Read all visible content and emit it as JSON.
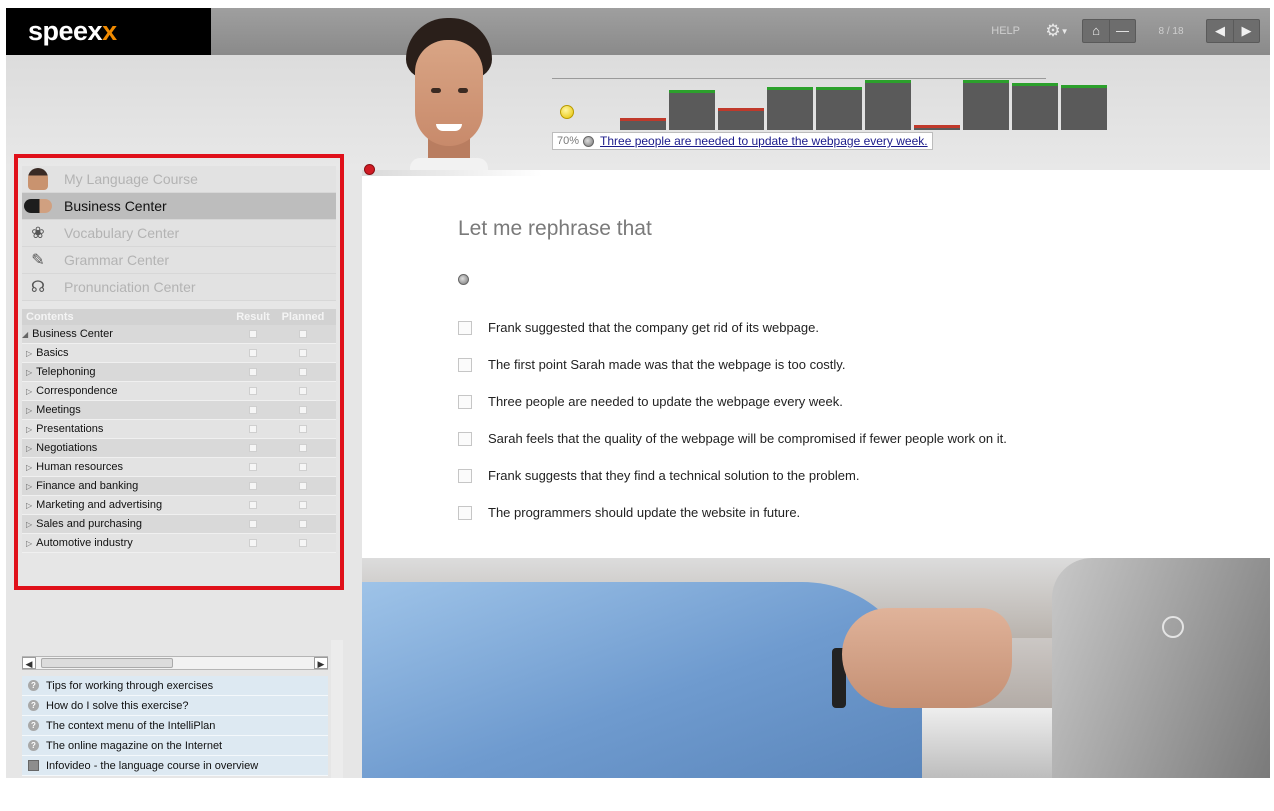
{
  "app": {
    "logo_text": "speex",
    "logo_accent": "x",
    "accent_color": "#f08a00"
  },
  "topbar": {
    "help_label": "HELP",
    "gear_icon": "gear-icon",
    "home_icon": "home-icon",
    "minimize_icon": "minimize-icon",
    "page_counter": "8 / 18",
    "prev_icon": "prev-icon",
    "next_icon": "next-icon"
  },
  "progress": {
    "percent_label": "70%",
    "current_sentence": "Three people are needed to update the webpage every week.",
    "status_color": "#e6c200",
    "answers": [
      {
        "level": 0.24,
        "correct": false
      },
      {
        "level": 0.8,
        "correct": true
      },
      {
        "level": 0.44,
        "correct": false
      },
      {
        "level": 0.86,
        "correct": true
      },
      {
        "level": 0.86,
        "correct": true
      },
      {
        "level": 1.0,
        "correct": true
      },
      {
        "level": 0.1,
        "correct": false
      },
      {
        "level": 1.0,
        "correct": true
      },
      {
        "level": 0.94,
        "correct": true
      },
      {
        "level": 0.9,
        "correct": true
      }
    ]
  },
  "centers": [
    {
      "label": "My Language Course",
      "icon": "person-icon",
      "active": false
    },
    {
      "label": "Business Center",
      "icon": "handshake-icon",
      "active": true
    },
    {
      "label": "Vocabulary Center",
      "icon": "vocabulary-icon",
      "active": false
    },
    {
      "label": "Grammar Center",
      "icon": "pen-icon",
      "active": false
    },
    {
      "label": "Pronunciation Center",
      "icon": "headset-icon",
      "active": false
    }
  ],
  "contents": {
    "headers": {
      "name": "Contents",
      "result": "Result",
      "planned": "Planned"
    },
    "group": "Business Center",
    "items": [
      "Basics",
      "Telephoning",
      "Correspondence",
      "Meetings",
      "Presentations",
      "Negotiations",
      "Human resources",
      "Finance and banking",
      "Marketing and advertising",
      "Sales and purchasing",
      "Automotive industry"
    ]
  },
  "help": {
    "items": [
      {
        "label": "Tips for working through exercises",
        "icon": "help-icon"
      },
      {
        "label": "How do I solve this exercise?",
        "icon": "help-icon"
      },
      {
        "label": "The context menu of the IntelliPlan",
        "icon": "help-icon"
      },
      {
        "label": "The online magazine on the Internet",
        "icon": "help-icon"
      },
      {
        "label": "Infovideo - the language course in overview",
        "icon": "video-icon"
      }
    ]
  },
  "exercise": {
    "title": "Let me rephrase that",
    "audio_icon": "speaker-icon",
    "options": [
      "Frank suggested that the company get rid of its webpage.",
      "The first point Sarah made was that the webpage is too costly.",
      "Three people are needed to update the webpage every week.",
      "Sarah feels that the quality of the webpage will be compromised if fewer people work on it.",
      "Frank suggests that they find a technical solution to the problem.",
      "The programmers should update the website in future."
    ]
  }
}
